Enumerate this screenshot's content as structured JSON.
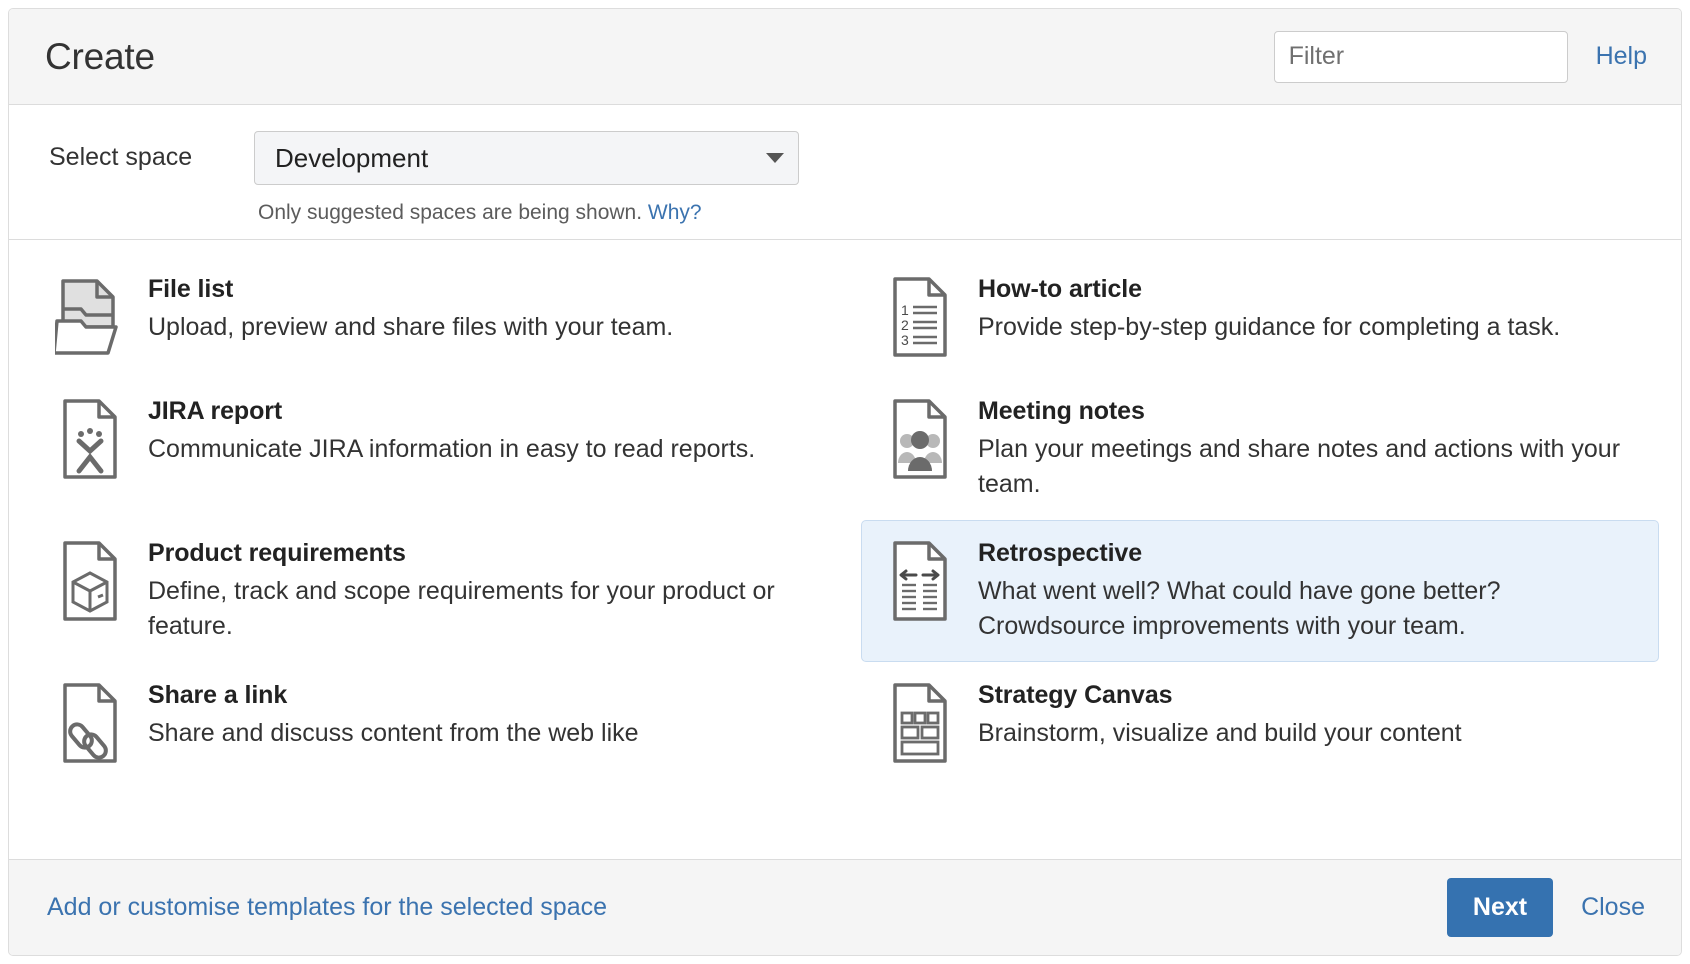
{
  "header": {
    "title": "Create",
    "filter_placeholder": "Filter",
    "filter_value": "",
    "help_label": "Help"
  },
  "space": {
    "label": "Select space",
    "selected": "Development",
    "hint_text": "Only suggested spaces are being shown.",
    "hint_link": "Why?"
  },
  "templates": [
    {
      "name": "File list",
      "description": "Upload, preview and share files with your team.",
      "icon": "file-list-icon",
      "selected": false
    },
    {
      "name": "How-to article",
      "description": "Provide step-by-step guidance for completing a task.",
      "icon": "how-to-article-icon",
      "selected": false
    },
    {
      "name": "JIRA report",
      "description": "Communicate JIRA information in easy to read reports.",
      "icon": "jira-report-icon",
      "selected": false
    },
    {
      "name": "Meeting notes",
      "description": "Plan your meetings and share notes and actions with your team.",
      "icon": "meeting-notes-icon",
      "selected": false
    },
    {
      "name": "Product requirements",
      "description": "Define, track and scope requirements for your product or feature.",
      "icon": "product-requirements-icon",
      "selected": false
    },
    {
      "name": "Retrospective",
      "description": "What went well? What could have gone better? Crowdsource improvements with your team.",
      "icon": "retrospective-icon",
      "selected": true
    },
    {
      "name": "Share a link",
      "description": "Share and discuss content from the web like",
      "icon": "share-a-link-icon",
      "selected": false
    },
    {
      "name": "Strategy Canvas",
      "description": "Brainstorm, visualize and build your content",
      "icon": "strategy-canvas-icon",
      "selected": false
    }
  ],
  "footer": {
    "customise_link": "Add or customise templates for the selected space",
    "next_label": "Next",
    "close_label": "Close"
  },
  "colors": {
    "accent_blue": "#3572b0",
    "link_blue": "#3b73af",
    "selected_bg": "#e9f2fb",
    "header_bg": "#f5f5f5",
    "icon_gray": "#6b6b6b"
  }
}
